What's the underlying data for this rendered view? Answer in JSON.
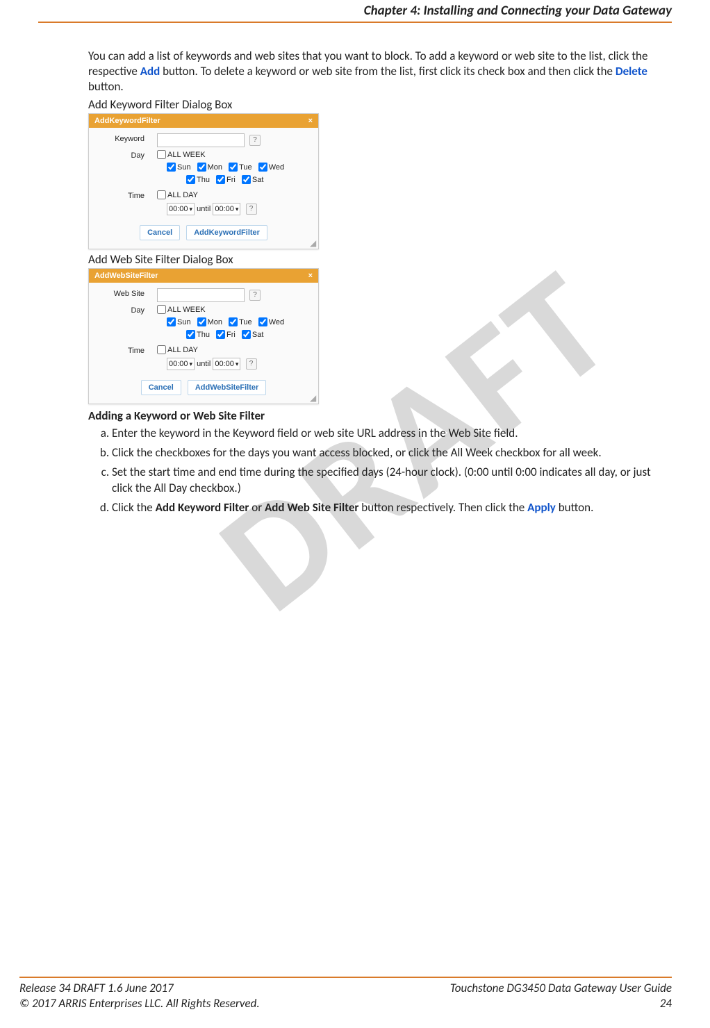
{
  "header": {
    "chapter": "Chapter 4: Installing and Connecting your Data Gateway"
  },
  "watermark": "DRAFT",
  "intro": {
    "text1": "You can add a list of keywords and web sites that you want to block. To add a keyword or web site to the list, click the respective ",
    "add": "Add",
    "text2": " button. To delete a keyword or web site from the list, first click its check box and then click the ",
    "delete": "Delete",
    "text3": " button."
  },
  "dialog_kw": {
    "caption": "Add Keyword Filter Dialog Box",
    "title": "AddKeywordFilter",
    "close": "×",
    "labels": {
      "keyword": "Keyword",
      "day": "Day",
      "time": "Time"
    },
    "allweek": "ALL WEEK",
    "days": [
      "Sun",
      "Mon",
      "Tue",
      "Wed",
      "Thu",
      "Fri",
      "Sat"
    ],
    "allday": "ALL DAY",
    "timeFrom": "00:00",
    "until": "until",
    "timeTo": "00:00",
    "cancel": "Cancel",
    "submit": "AddKeywordFilter"
  },
  "dialog_ws": {
    "caption": "Add Web Site Filter Dialog Box",
    "title": "AddWebSiteFilter",
    "close": "×",
    "labels": {
      "website": "Web Site",
      "day": "Day",
      "time": "Time"
    },
    "allweek": "ALL WEEK",
    "days": [
      "Sun",
      "Mon",
      "Tue",
      "Wed",
      "Thu",
      "Fri",
      "Sat"
    ],
    "allday": "ALL DAY",
    "timeFrom": "00:00",
    "until": "until",
    "timeTo": "00:00",
    "cancel": "Cancel",
    "submit": "AddWebSiteFilter"
  },
  "section": {
    "heading": "Adding a Keyword or Web Site Filter",
    "a": "Enter the keyword in the Keyword field or web site URL address in the Web Site field.",
    "b": "Click the checkboxes for the days you want access blocked, or click the All Week checkbox for all week.",
    "c": "Set the start time and end time during the specified days (24-hour clock). (0:00 until 0:00 indicates all day, or just click the All Day checkbox.)",
    "d1": "Click the ",
    "d_kw": "Add Keyword Filter",
    "d_or": " or ",
    "d_ws": "Add Web Site Filter",
    "d2": " button respectively. Then click the ",
    "d_apply": "Apply",
    "d3": " button."
  },
  "footer": {
    "left1": "Release 34 DRAFT 1.6   June 2017",
    "right1": "Touchstone DG3450 Data Gateway User Guide",
    "left2": "© 2017 ARRIS Enterprises LLC. All Rights Reserved.",
    "right2": "24"
  }
}
